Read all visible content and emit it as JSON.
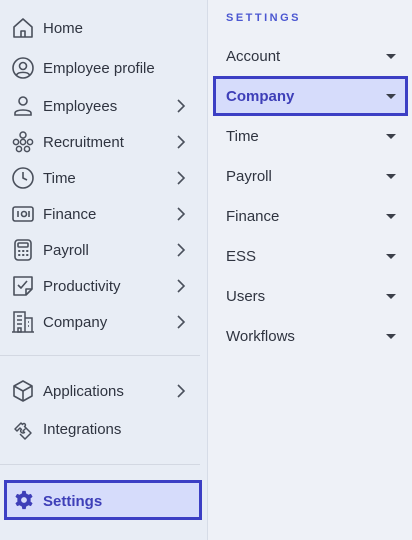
{
  "sidebar": {
    "items": [
      {
        "label": "Home",
        "icon": "home-icon",
        "chevron": false
      },
      {
        "label": "Employee profile",
        "icon": "user-circle-icon",
        "chevron": false
      },
      {
        "label": "Employees",
        "icon": "person-icon",
        "chevron": true
      },
      {
        "label": "Recruitment",
        "icon": "people-group-icon",
        "chevron": true
      },
      {
        "label": "Time",
        "icon": "clock-icon",
        "chevron": true
      },
      {
        "label": "Finance",
        "icon": "banknote-icon",
        "chevron": true
      },
      {
        "label": "Payroll",
        "icon": "calculator-icon",
        "chevron": true
      },
      {
        "label": "Productivity",
        "icon": "checklist-icon",
        "chevron": true
      },
      {
        "label": "Company",
        "icon": "building-icon",
        "chevron": true
      }
    ],
    "secondary": [
      {
        "label": "Applications",
        "icon": "cube-icon",
        "chevron": true
      },
      {
        "label": "Integrations",
        "icon": "puzzle-icon",
        "chevron": false
      }
    ],
    "settings": {
      "label": "Settings",
      "icon": "gear-icon",
      "active": true
    }
  },
  "settings_panel": {
    "title": "SETTINGS",
    "items": [
      {
        "label": "Account",
        "active": false
      },
      {
        "label": "Company",
        "active": true
      },
      {
        "label": "Time",
        "active": false
      },
      {
        "label": "Payroll",
        "active": false
      },
      {
        "label": "Finance",
        "active": false
      },
      {
        "label": "ESS",
        "active": false
      },
      {
        "label": "Users",
        "active": false
      },
      {
        "label": "Workflows",
        "active": false
      }
    ]
  },
  "colors": {
    "accent": "#3c3fc4",
    "accent_text": "#3e3fb8",
    "highlight_bg": "#d6dcfb",
    "sidebar_bg": "#e8edf5",
    "panel_bg": "#eef1f7",
    "section_title": "#4b57d1"
  }
}
